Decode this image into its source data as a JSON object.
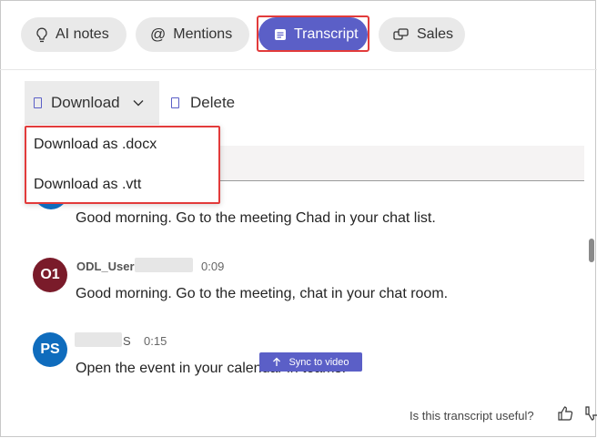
{
  "tabs": [
    {
      "label": "AI notes",
      "icon": "lightbulb-icon"
    },
    {
      "label": "Mentions",
      "icon": "at-icon"
    },
    {
      "label": "Transcript",
      "icon": "document-icon",
      "active": true
    },
    {
      "label": "Sales",
      "icon": "sales-icon"
    }
  ],
  "toolbar": {
    "download_label": "Download",
    "delete_label": "Delete"
  },
  "download_menu": {
    "items": [
      "Download as .docx",
      "Download as .vtt"
    ]
  },
  "transcript": {
    "entries": [
      {
        "initials": "",
        "speaker": "",
        "time": "",
        "text": "Good morning. Go to the meeting Chad in your chat list."
      },
      {
        "initials": "O1",
        "speaker": "ODL_User",
        "time": "0:09",
        "text": "Good morning. Go to the meeting, chat in your chat room.",
        "avatar_color": "#7a1b2a"
      },
      {
        "initials": "PS",
        "speaker": "S",
        "time": "0:15",
        "text": "Open the event in your calendar in teams.",
        "avatar_color": "#0f6cbd"
      }
    ],
    "sync_label": "Sync to video"
  },
  "feedback": {
    "question": "Is this transcript useful?"
  },
  "colors": {
    "accent": "#5b5fc7",
    "highlight": "#e23b3b"
  }
}
